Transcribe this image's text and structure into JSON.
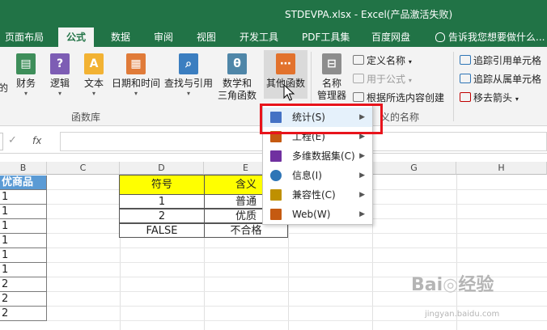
{
  "window": {
    "title": "STDEVPA.xlsx - Excel(产品激活失败)"
  },
  "tabs": [
    {
      "label": "页面布局"
    },
    {
      "label": "公式"
    },
    {
      "label": "数据"
    },
    {
      "label": "审阅"
    },
    {
      "label": "视图"
    },
    {
      "label": "开发工具"
    },
    {
      "label": "PDF工具集"
    },
    {
      "label": "百度网盘"
    }
  ],
  "tell_me": "告诉我您想要做什么...",
  "ribbon": {
    "function_library": {
      "partial_left": "的",
      "finance": "财务",
      "logic": "逻辑",
      "text": "文本",
      "datetime": "日期和时间",
      "lookup": "查找与引用",
      "math_line1": "数学和",
      "math_line2": "三角函数",
      "other_functions": "其他函数",
      "group_label": "函数库"
    },
    "defined_names": {
      "name_manager_line1": "名称",
      "name_manager_line2": "管理器",
      "define_name": "定义名称",
      "use_in_formula": "用于公式",
      "create_from_selection": "根据所选内容创建",
      "group_label_visible": "义的名称"
    },
    "formula_auditing": {
      "trace_precedents": "追踪引用单元格",
      "trace_dependents": "追踪从属单元格",
      "remove_arrows": "移去箭头"
    }
  },
  "formula_bar": {
    "fx_label": "fx",
    "value": ""
  },
  "columns": [
    "B",
    "C",
    "D",
    "E",
    "F",
    "G",
    "H"
  ],
  "column_b": {
    "header": "优商品",
    "values": [
      "1",
      "1",
      "1",
      "1",
      "1",
      "1",
      "2",
      "2",
      "2"
    ]
  },
  "table": {
    "headers": [
      "符号",
      "含义"
    ],
    "rows": [
      [
        "1",
        "普通"
      ],
      [
        "2",
        "优质"
      ],
      [
        "FALSE",
        "不合格"
      ]
    ]
  },
  "menu": {
    "items": [
      {
        "label": "统计(S)",
        "color": "#4472c4"
      },
      {
        "label": "工程(E)",
        "color": "#c55a11"
      },
      {
        "label": "多维数据集(C)",
        "color": "#7030a0"
      },
      {
        "label": "信息(I)",
        "color": "#2e75b6"
      },
      {
        "label": "兼容性(C)",
        "color": "#bf9000"
      },
      {
        "label": "Web(W)",
        "color": "#c55a11"
      }
    ]
  },
  "colors": {
    "excel_green": "#217346",
    "highlight_red": "#e8141c",
    "header_yellow": "#ffff00",
    "header_blue": "#5b9bd5"
  }
}
